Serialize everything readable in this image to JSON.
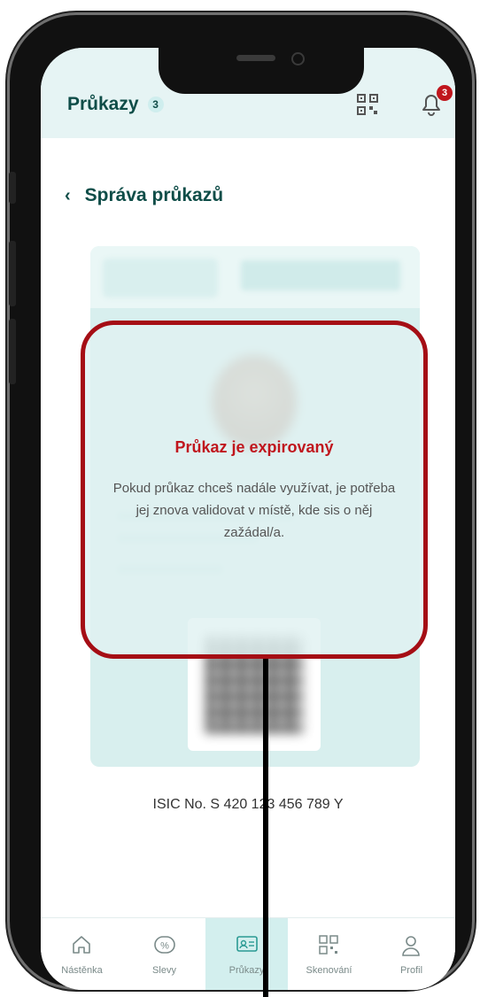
{
  "header": {
    "title": "Průkazy",
    "count": "3",
    "notification_count": "3"
  },
  "nav": {
    "back_label": "Správa průkazů"
  },
  "card_overlay": {
    "title": "Průkaz je expirovaný",
    "message": "Pokud průkaz chceš nadále využívat, je potřeba jej znova validovat v místě, kde sis o něj zažádal/a."
  },
  "isic": {
    "text": "ISIC No.  S 420 123 456 789 Y"
  },
  "tabs": [
    {
      "label": "Nástěnka",
      "icon": "home-icon"
    },
    {
      "label": "Slevy",
      "icon": "percent-icon"
    },
    {
      "label": "Průkazy",
      "icon": "id-card-icon",
      "active": true
    },
    {
      "label": "Skenování",
      "icon": "qr-scan-icon"
    },
    {
      "label": "Profil",
      "icon": "user-icon"
    }
  ],
  "colors": {
    "accent": "#0f4d48",
    "alert": "#c0161d",
    "highlight_border": "#a50e15",
    "card_bg": "#d8efee"
  }
}
